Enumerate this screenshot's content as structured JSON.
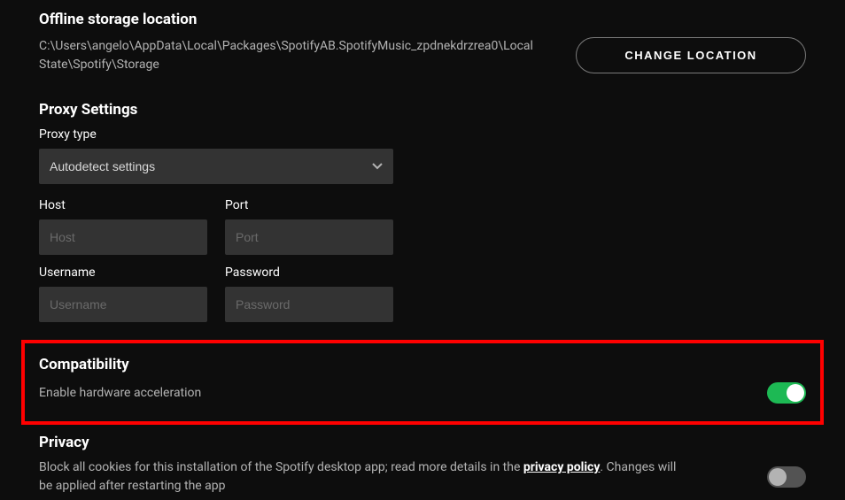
{
  "storage": {
    "heading": "Offline storage location",
    "path": "C:\\Users\\angelo\\AppData\\Local\\Packages\\SpotifyAB.SpotifyMusic_zpdnekdrzrea0\\LocalState\\Spotify\\Storage",
    "change_button": "CHANGE LOCATION"
  },
  "proxy": {
    "heading": "Proxy Settings",
    "type_label": "Proxy type",
    "type_value": "Autodetect settings",
    "host_label": "Host",
    "host_placeholder": "Host",
    "port_label": "Port",
    "port_placeholder": "Port",
    "username_label": "Username",
    "username_placeholder": "Username",
    "password_label": "Password",
    "password_placeholder": "Password"
  },
  "compatibility": {
    "heading": "Compatibility",
    "hw_accel_label": "Enable hardware acceleration",
    "hw_accel_on": true
  },
  "privacy": {
    "heading": "Privacy",
    "cookies_text_pre": "Block all cookies for this installation of the Spotify desktop app; read more details in the ",
    "cookies_link": "privacy policy",
    "cookies_text_post": ". Changes will be applied after restarting the app",
    "cookies_on": false
  }
}
